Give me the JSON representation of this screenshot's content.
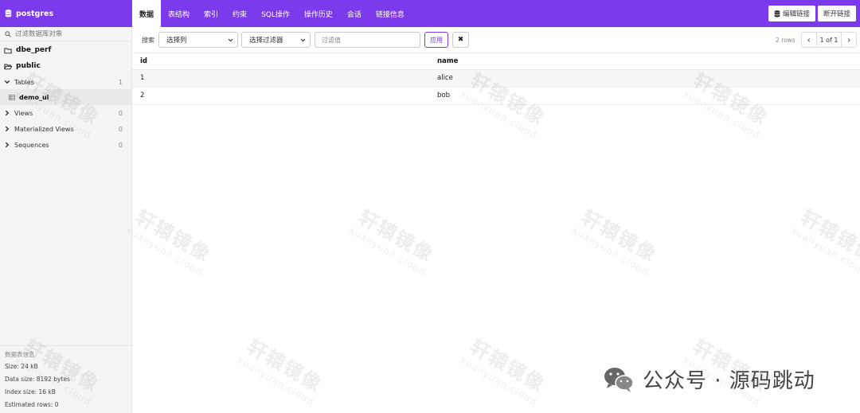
{
  "app": {
    "db_name": "postgres",
    "brand_icon": "database-icon"
  },
  "tabs": [
    {
      "label": "数据",
      "active": true
    },
    {
      "label": "表结构"
    },
    {
      "label": "索引"
    },
    {
      "label": "约束"
    },
    {
      "label": "SQL操作"
    },
    {
      "label": "操作历史"
    },
    {
      "label": "会话"
    },
    {
      "label": "链接信息"
    }
  ],
  "top_actions": {
    "edit_label": "编辑链接",
    "disconnect_label": "断开链接"
  },
  "sidebar": {
    "search_placeholder": "过滤数据库对象",
    "schemas": [
      "dbe_perf",
      "public"
    ],
    "groups": {
      "tables": {
        "label": "Tables",
        "count": "1"
      },
      "views": {
        "label": "Views",
        "count": "0"
      },
      "mviews": {
        "label": "Materialized Views",
        "count": "0"
      },
      "sequences": {
        "label": "Sequences",
        "count": "0"
      }
    },
    "table_item": "demo_ui",
    "info": {
      "title": "数据表信息",
      "size": "Size: 24 kB",
      "data_size": "Data size: 8192 bytes",
      "index_size": "Index size: 16 kB",
      "est_rows": "Estimated rows: 0"
    }
  },
  "filter": {
    "label": "搜索",
    "column_select": "选择列",
    "filter_select": "选择过滤器",
    "value_placeholder": "过滤值",
    "apply_label": "应用",
    "clear_label": "✖",
    "rows_text": "2 rows",
    "page_text": "1 of 1"
  },
  "table": {
    "columns": [
      "id",
      "name"
    ],
    "rows": [
      [
        "1",
        "alice"
      ],
      [
        "2",
        "bob"
      ]
    ]
  },
  "watermark": {
    "text": "轩辕镜像",
    "subtext": "xuanyuan.cloud"
  },
  "overlay": {
    "text": "公众号 · 源码跳动",
    "icon": "wechat-icon"
  },
  "colors": {
    "accent": "#7c3aed"
  }
}
